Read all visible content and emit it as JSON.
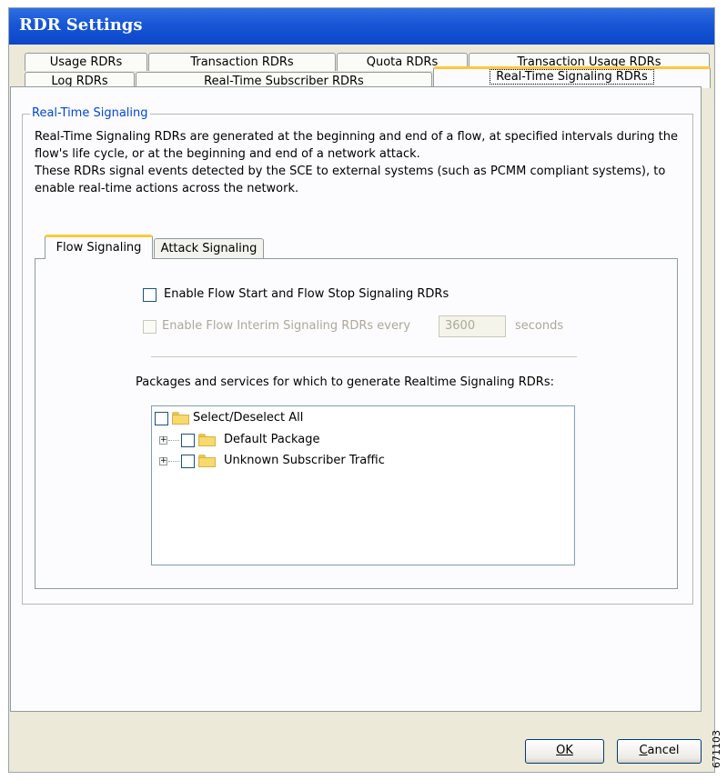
{
  "window": {
    "title": "RDR Settings"
  },
  "tabs_row1": [
    {
      "label": "Usage RDRs"
    },
    {
      "label": "Transaction RDRs"
    },
    {
      "label": "Quota RDRs"
    },
    {
      "label": "Transaction Usage RDRs"
    }
  ],
  "tabs_row2": [
    {
      "label": "Log RDRs"
    },
    {
      "label": "Real-Time Subscriber RDRs"
    },
    {
      "label": "Real-Time Signaling RDRs",
      "active": true
    }
  ],
  "group": {
    "legend": "Real-Time Signaling",
    "desc_line1": "Real-Time Signaling RDRs are generated at the beginning and end of a flow, at specified intervals during the flow's life cycle, or at the beginning and end of a network attack.",
    "desc_line2": "These RDRs signal events detected by the SCE to external systems (such as PCMM compliant systems), to enable real-time actions across the network."
  },
  "inner_tabs": [
    {
      "label": "Flow Signaling",
      "active": true
    },
    {
      "label": "Attack Signaling"
    }
  ],
  "flow": {
    "enable_start_stop_label": "Enable Flow Start and Flow Stop Signaling RDRs",
    "enable_start_stop_checked": false,
    "enable_interim_label": "Enable Flow Interim Signaling RDRs every",
    "interim_value": "3600",
    "interim_unit": "seconds",
    "packages_label": "Packages and services for which to generate Realtime Signaling RDRs:"
  },
  "tree": {
    "root_label": "Select/Deselect All",
    "items": [
      {
        "label": "Default Package"
      },
      {
        "label": "Unknown Subscriber Traffic"
      }
    ]
  },
  "buttons": {
    "ok": "OK",
    "cancel": "Cancel"
  },
  "side_mark": "671103",
  "colors": {
    "titlebar": "#1756d6",
    "tab_highlight": "#ffc73c",
    "legend": "#0046d5"
  }
}
